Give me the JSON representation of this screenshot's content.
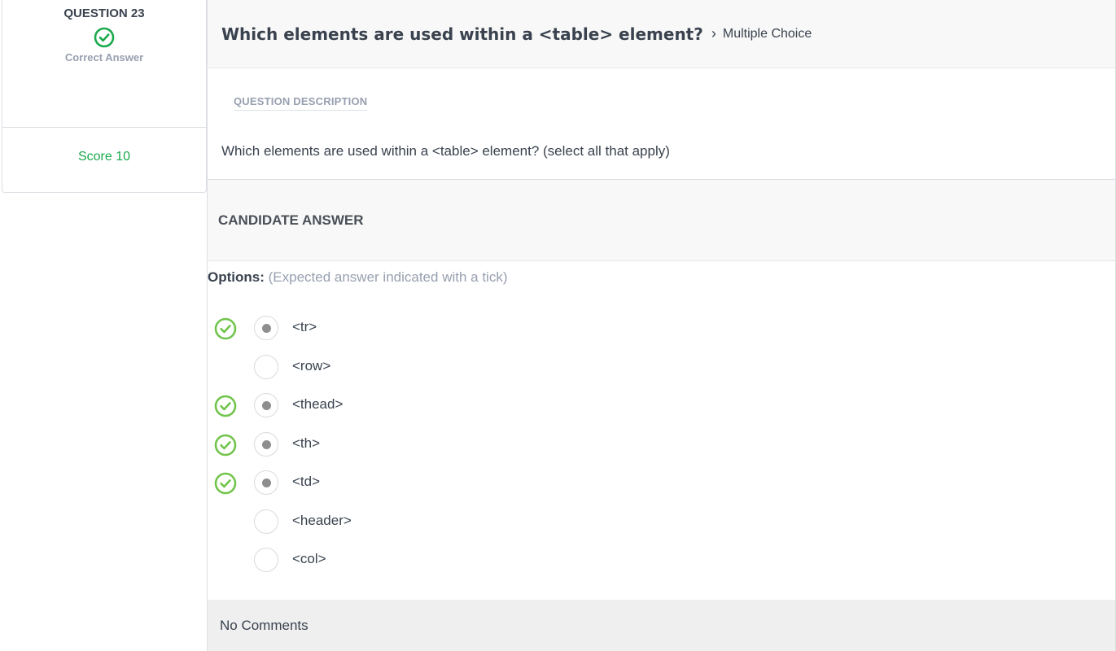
{
  "summary": {
    "question_number": "QUESTION 23",
    "status_icon": "check-circle-icon",
    "status_text": "Correct Answer",
    "score": "Score 10",
    "colors": {
      "correct": "#1ba94c",
      "muted": "#979faf"
    }
  },
  "question": {
    "title": "Which elements are used within a <table> element?",
    "separator": "›",
    "type": "Multiple Choice",
    "description_label": "QUESTION DESCRIPTION",
    "description": "Which elements are used within a <table> element? (select all that apply)"
  },
  "candidate": {
    "title": "CANDIDATE ANSWER",
    "options_label": "Options:",
    "options_hint": "(Expected answer indicated with a tick)",
    "options": [
      {
        "text": "<tr>",
        "expected": true,
        "selected": true
      },
      {
        "text": "<row>",
        "expected": false,
        "selected": false
      },
      {
        "text": "<thead>",
        "expected": true,
        "selected": true
      },
      {
        "text": "<th>",
        "expected": true,
        "selected": true
      },
      {
        "text": "<td>",
        "expected": true,
        "selected": true
      },
      {
        "text": "<header>",
        "expected": false,
        "selected": false
      },
      {
        "text": "<col>",
        "expected": false,
        "selected": false
      }
    ],
    "tick_color": "#71c44b"
  },
  "comments": {
    "text": "No Comments"
  }
}
